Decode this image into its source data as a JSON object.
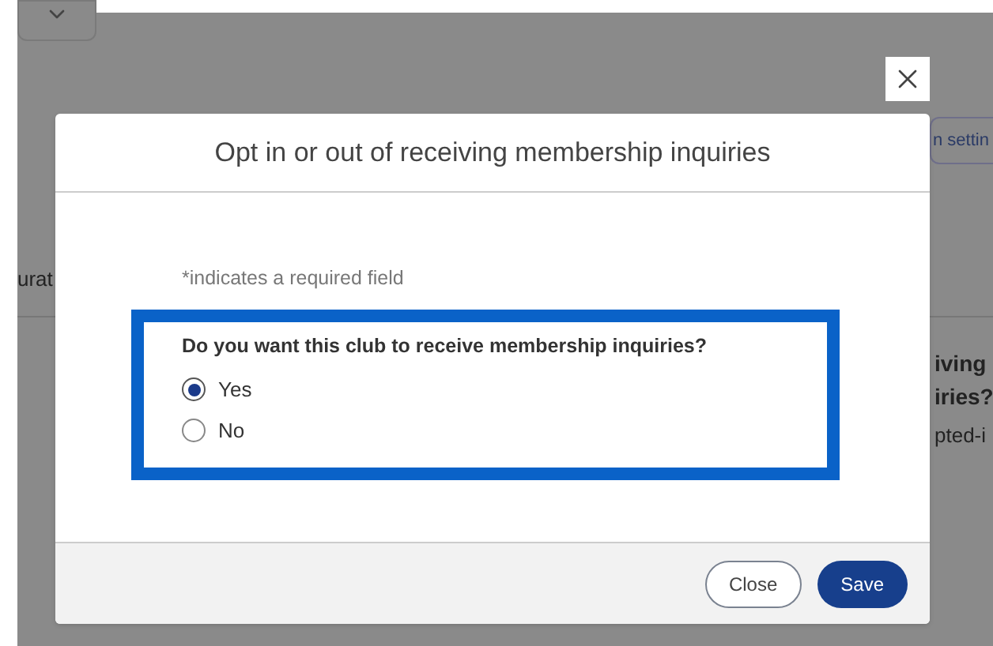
{
  "background": {
    "left_texts": [
      "urat"
    ],
    "right_button": "n settin",
    "right_texts": [
      {
        "text": "iving",
        "kind": "heading"
      },
      {
        "text": "iries?",
        "kind": "heading"
      },
      {
        "text": "pted-i",
        "kind": "body"
      }
    ]
  },
  "dialog": {
    "title": "Opt in or out of receiving membership inquiries",
    "required_note": "*indicates a required field",
    "question": "Do you want this club to receive membership inquiries?",
    "options": [
      {
        "label": "Yes",
        "selected": true
      },
      {
        "label": "No",
        "selected": false
      }
    ],
    "buttons": [
      {
        "label": "Close",
        "kind": "secondary"
      },
      {
        "label": "Save",
        "kind": "primary"
      }
    ]
  }
}
